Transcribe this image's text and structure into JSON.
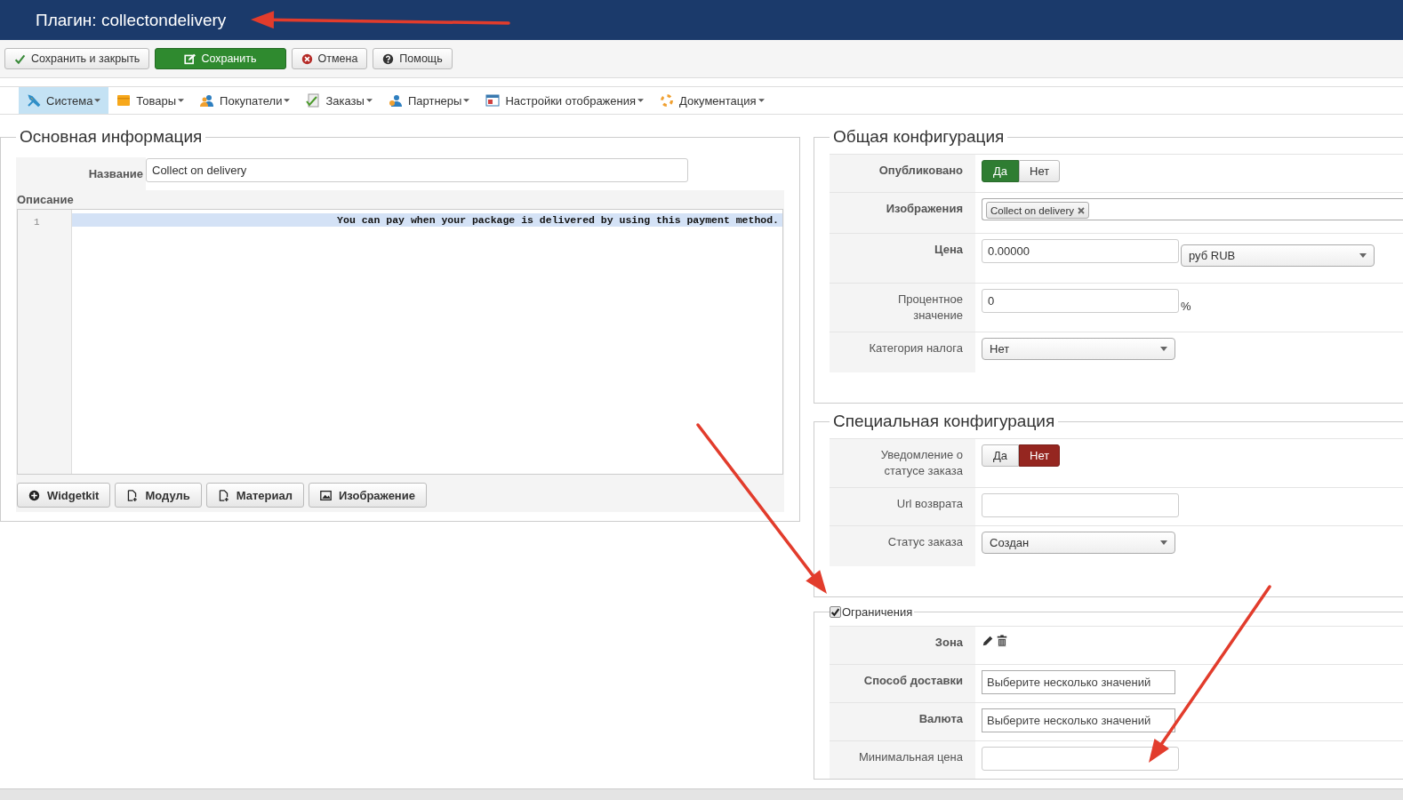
{
  "header": {
    "title": "Плагин: collectondelivery"
  },
  "toolbar": {
    "buttons": [
      {
        "label": "Сохранить и закрыть",
        "kind": "check"
      },
      {
        "label": "Сохранить",
        "kind": "save"
      },
      {
        "label": "Отмена",
        "kind": "cancel"
      },
      {
        "label": "Помощь",
        "kind": "help"
      }
    ]
  },
  "menu": {
    "items": [
      {
        "label": "Система",
        "kind": "tools",
        "selected": true
      },
      {
        "label": "Товары",
        "kind": "box",
        "selected": false
      },
      {
        "label": "Покупатели",
        "kind": "users",
        "selected": false
      },
      {
        "label": "Заказы",
        "kind": "orders",
        "selected": false
      },
      {
        "label": "Партнеры",
        "kind": "partners",
        "selected": false
      },
      {
        "label": "Настройки отображения",
        "kind": "display",
        "selected": false
      },
      {
        "label": "Документация",
        "kind": "docs",
        "selected": false
      }
    ]
  },
  "main_info": {
    "legend": "Основная информация",
    "name_label": "Название",
    "name_value": "Collect on delivery",
    "description_label": "Описание",
    "editor": {
      "line_number": "1",
      "text": "You can pay when your package is delivered by using this payment method."
    },
    "buttons": [
      {
        "label": "Widgetkit",
        "kind": "plus"
      },
      {
        "label": "Модуль",
        "kind": "doc"
      },
      {
        "label": "Материал",
        "kind": "doc"
      },
      {
        "label": "Изображение",
        "kind": "image"
      }
    ]
  },
  "general_config": {
    "legend": "Общая конфигурация",
    "rows": [
      {
        "label": "Опубликовано",
        "bold": true,
        "kind": "toggle",
        "options": [
          {
            "label": "Да",
            "kind": "yes",
            "selected": true
          },
          {
            "label": "Нет",
            "kind": "no",
            "selected": false
          }
        ]
      },
      {
        "label": "Изображения",
        "bold": true,
        "kind": "tags",
        "tags": [
          "Collect on delivery"
        ]
      },
      {
        "label": "Цена",
        "bold": true,
        "kind": "price",
        "value": "0.00000",
        "select": "руб RUB"
      },
      {
        "label": "Процентное значение",
        "bold": false,
        "kind": "percent",
        "value": "0",
        "suffix": "%"
      },
      {
        "label": "Категория налога",
        "bold": false,
        "kind": "select",
        "value": "Нет"
      }
    ]
  },
  "special_config": {
    "legend": "Специальная конфигурация",
    "rows": [
      {
        "label": "Уведомление о статусе заказа",
        "bold": false,
        "kind": "toggle",
        "options": [
          {
            "label": "Да",
            "kind": "yes",
            "selected": false
          },
          {
            "label": "Нет",
            "kind": "no",
            "selected": true
          }
        ]
      },
      {
        "label": "Url возврата",
        "bold": false,
        "kind": "input",
        "value": ""
      },
      {
        "label": "Статус заказа",
        "bold": false,
        "kind": "select",
        "value": "Создан"
      }
    ]
  },
  "restrictions": {
    "legend": "Ограничения",
    "checked": true,
    "rows": [
      {
        "label": "Зона",
        "bold": true,
        "kind": "zone"
      },
      {
        "label": "Способ доставки",
        "bold": true,
        "kind": "multi",
        "placeholder": "Выберите несколько значений"
      },
      {
        "label": "Валюта",
        "bold": true,
        "kind": "multi",
        "placeholder": "Выберите несколько значений"
      },
      {
        "label": "Минимальная цена",
        "bold": false,
        "kind": "input",
        "value": ""
      }
    ]
  }
}
